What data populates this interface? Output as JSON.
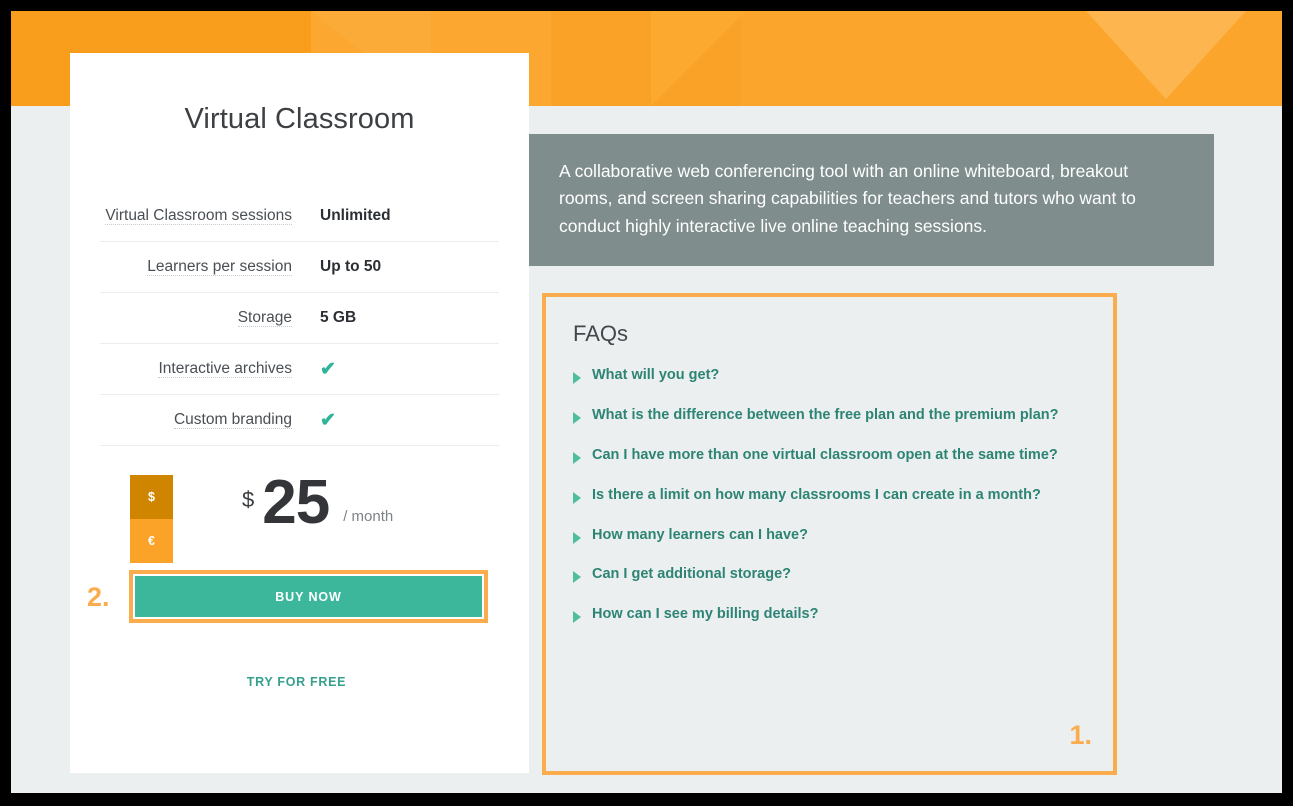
{
  "theme": {
    "accent_orange": "#fba229",
    "annotation_orange": "#fbad4e",
    "teal": "#3cb79b",
    "teal_text": "#2d8475",
    "panel_gray": "#7f8d8d",
    "page_bg": "#eceff0",
    "currency_selected": "#cf8500"
  },
  "card": {
    "title": "Virtual Classroom",
    "features": [
      {
        "label": "Virtual Classroom sessions",
        "value": "Unlimited",
        "type": "text"
      },
      {
        "label": "Learners per session",
        "value": "Up to 50",
        "type": "text"
      },
      {
        "label": "Storage",
        "value": "5 GB",
        "type": "text"
      },
      {
        "label": "Interactive archives",
        "value": "✔",
        "type": "check"
      },
      {
        "label": "Custom branding",
        "value": "✔",
        "type": "check"
      }
    ],
    "currency": {
      "selected": "$",
      "options": [
        "$",
        "€"
      ],
      "unselected": "€"
    },
    "price": {
      "symbol": "$",
      "amount": "25",
      "period": "/ month"
    },
    "buy_label": "BUY NOW",
    "try_label": "TRY FOR FREE"
  },
  "description": {
    "text": "A collaborative web conferencing tool with an online whiteboard, breakout rooms, and screen sharing capabilities for teachers and tutors who want to conduct highly interactive live online teaching sessions."
  },
  "faq": {
    "title": "FAQs",
    "items": [
      "What will you get?",
      "What is the difference between the free plan and the premium plan?",
      "Can I have more than one virtual classroom open at the same time?",
      "Is there a limit on how many classrooms I can create in a month?",
      "How many learners can I have?",
      "Can I get additional storage?",
      "How can I see my billing details?"
    ]
  },
  "annotations": {
    "faq_step": "1.",
    "buy_step": "2."
  }
}
